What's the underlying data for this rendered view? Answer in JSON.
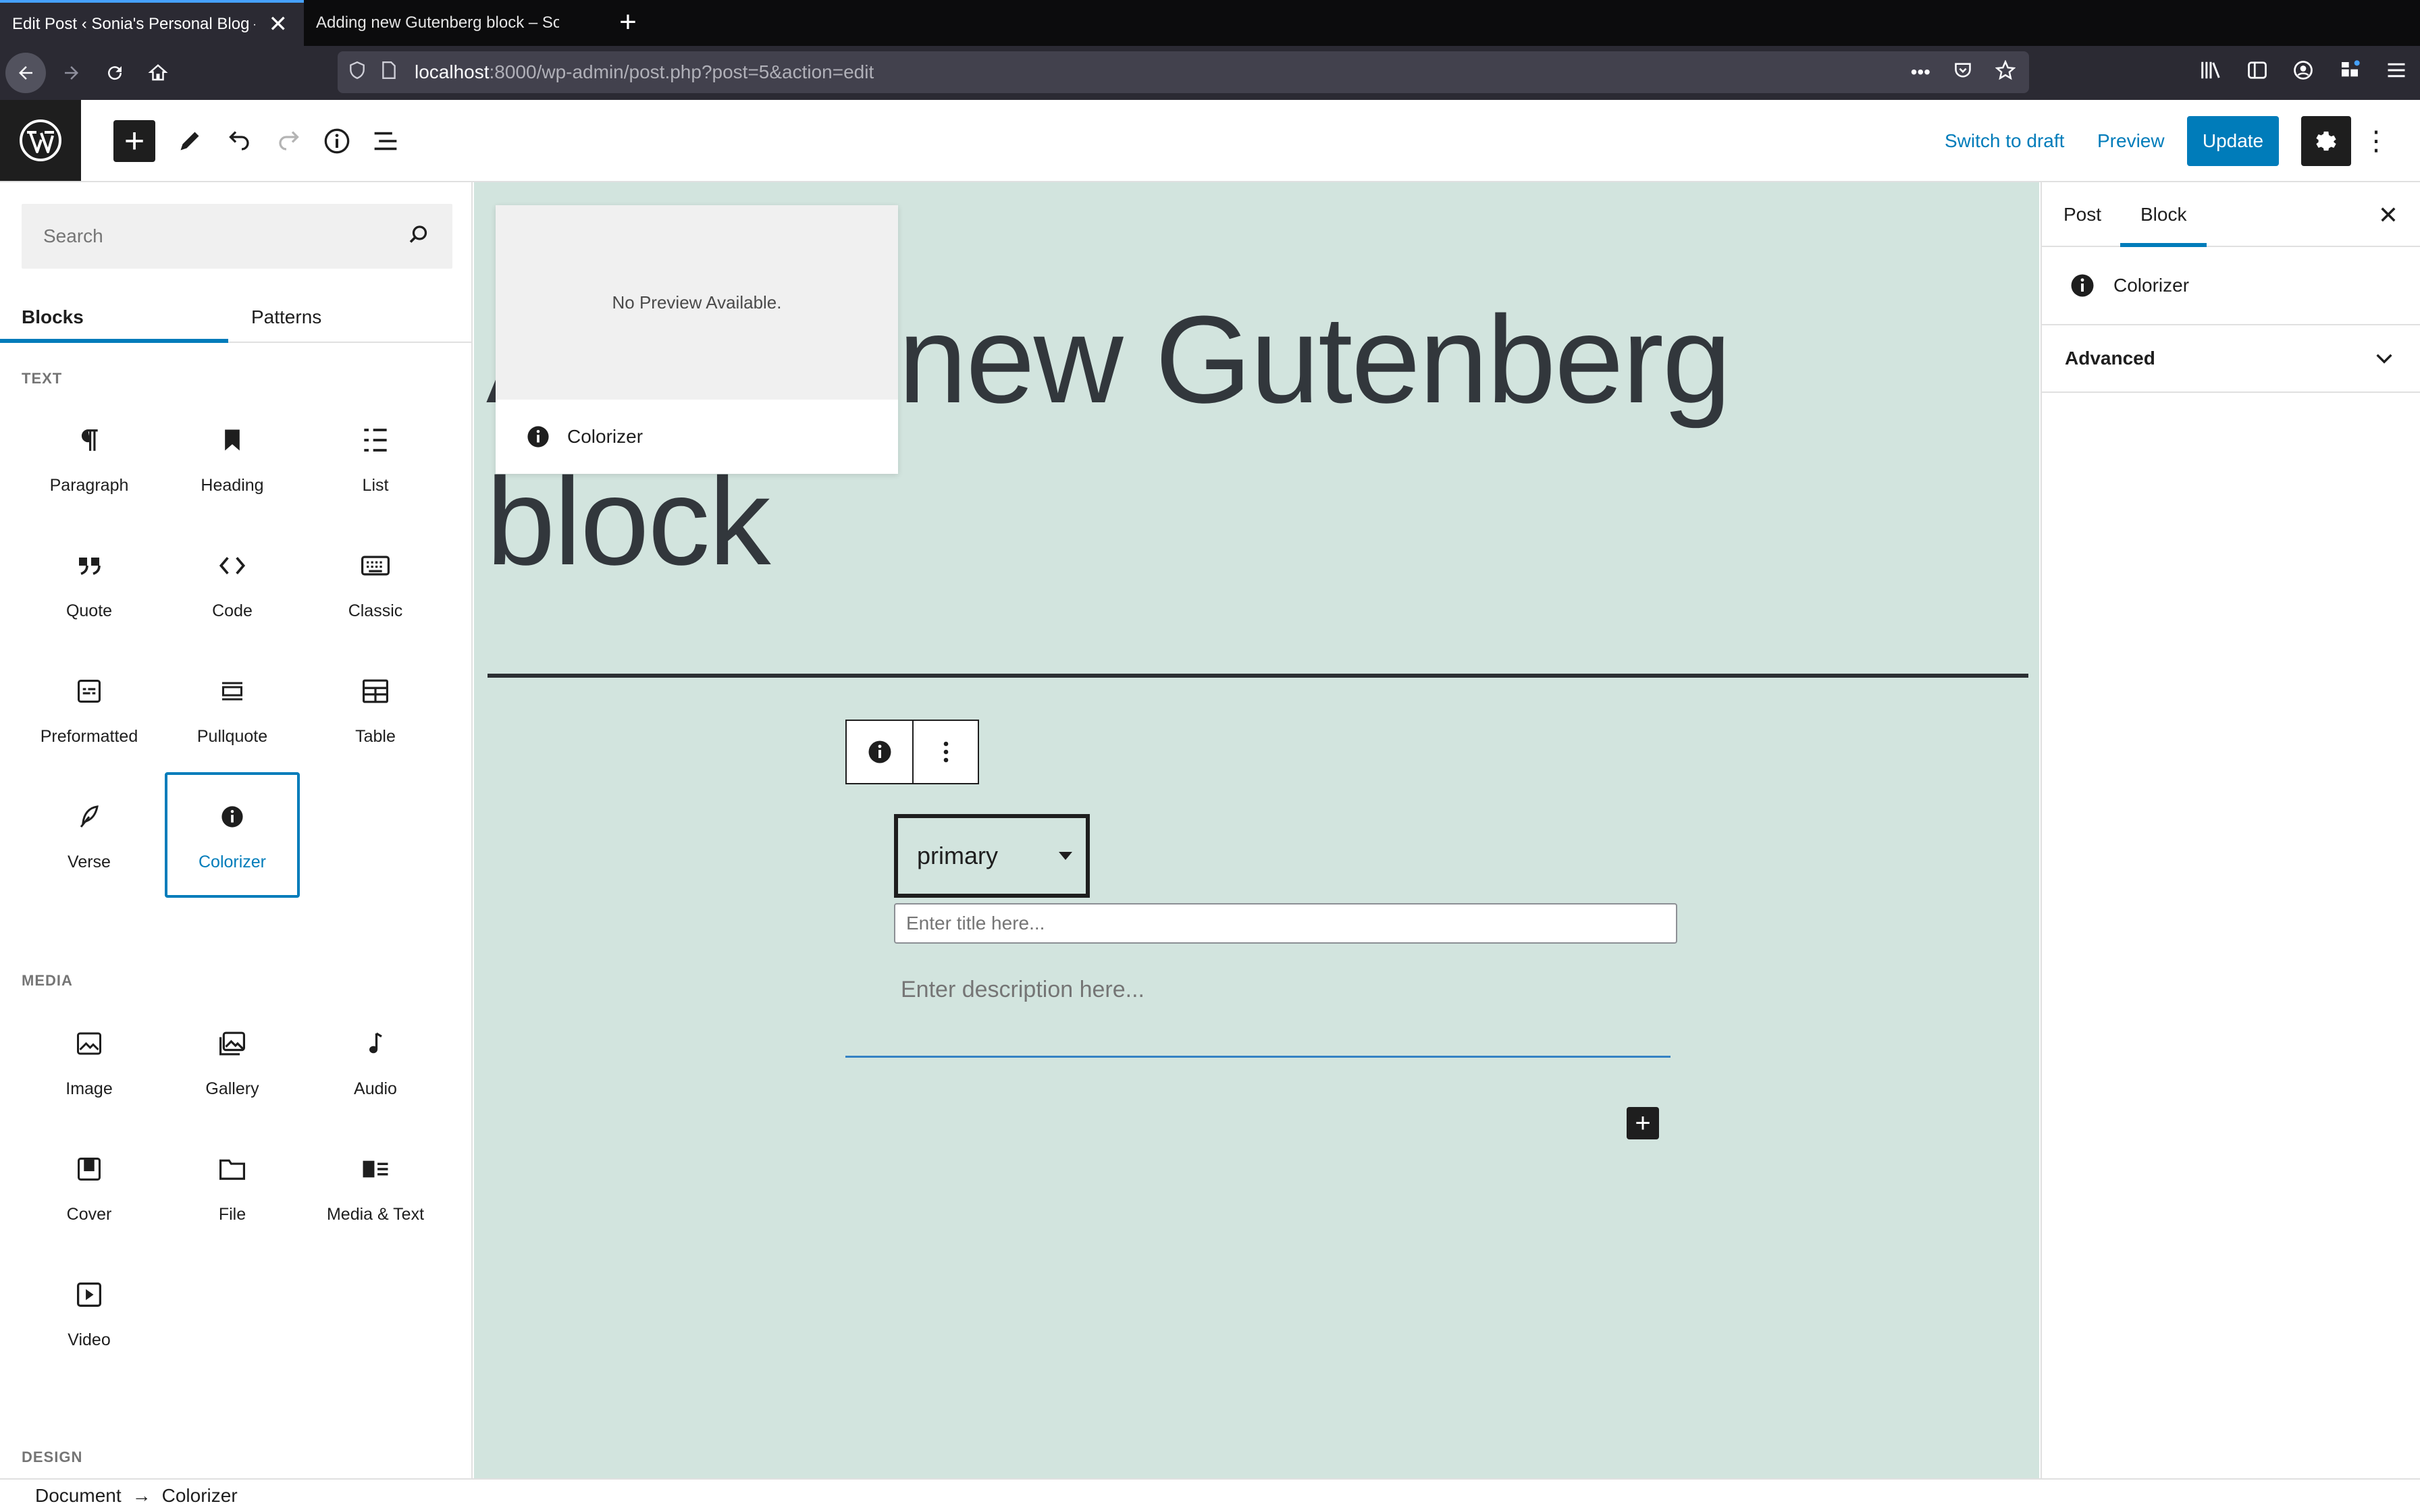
{
  "browser": {
    "tabs": [
      {
        "title": "Edit Post ‹ Sonia's Personal Blog — ",
        "close": "✕",
        "active": true
      },
      {
        "title": "Adding new Gutenberg block – Soni",
        "active": false
      }
    ],
    "new_tab": "+",
    "url_host": "localhost",
    "url_path": ":8000/wp-admin/post.php?post=5&action=edit",
    "url_more": "•••"
  },
  "header": {
    "inserter_label": "+",
    "switch_to_draft": "Switch to draft",
    "preview": "Preview",
    "update": "Update",
    "more": "⋮"
  },
  "inserter": {
    "search_placeholder": "Search",
    "tabs": [
      "Blocks",
      "Patterns"
    ],
    "categories": {
      "text": "TEXT",
      "media": "MEDIA",
      "design": "DESIGN"
    },
    "text_blocks": [
      "Paragraph",
      "Heading",
      "List",
      "Quote",
      "Code",
      "Classic",
      "Preformatted",
      "Pullquote",
      "Table",
      "Verse",
      "Colorizer"
    ],
    "media_blocks": [
      "Image",
      "Gallery",
      "Audio",
      "Cover",
      "File",
      "Media & Text",
      "Video"
    ]
  },
  "canvas": {
    "title_line1": "Adding new Gutenberg",
    "title_line2": "block",
    "preview_text": "No Preview Available.",
    "preview_block_name": "Colorizer",
    "select_value": "primary",
    "title_placeholder": "Enter title here...",
    "description_placeholder": "Enter description here...",
    "add_block": "+"
  },
  "settings": {
    "tabs": [
      "Post",
      "Block"
    ],
    "close": "✕",
    "block_name": "Colorizer",
    "advanced": "Advanced"
  },
  "footer": {
    "crumb_root": "Document",
    "arrow": "→",
    "crumb_current": "Colorizer"
  },
  "colors": {
    "accent": "#007cba",
    "canvas_bg": "#d2e4de",
    "dark": "#1e1e1e"
  }
}
